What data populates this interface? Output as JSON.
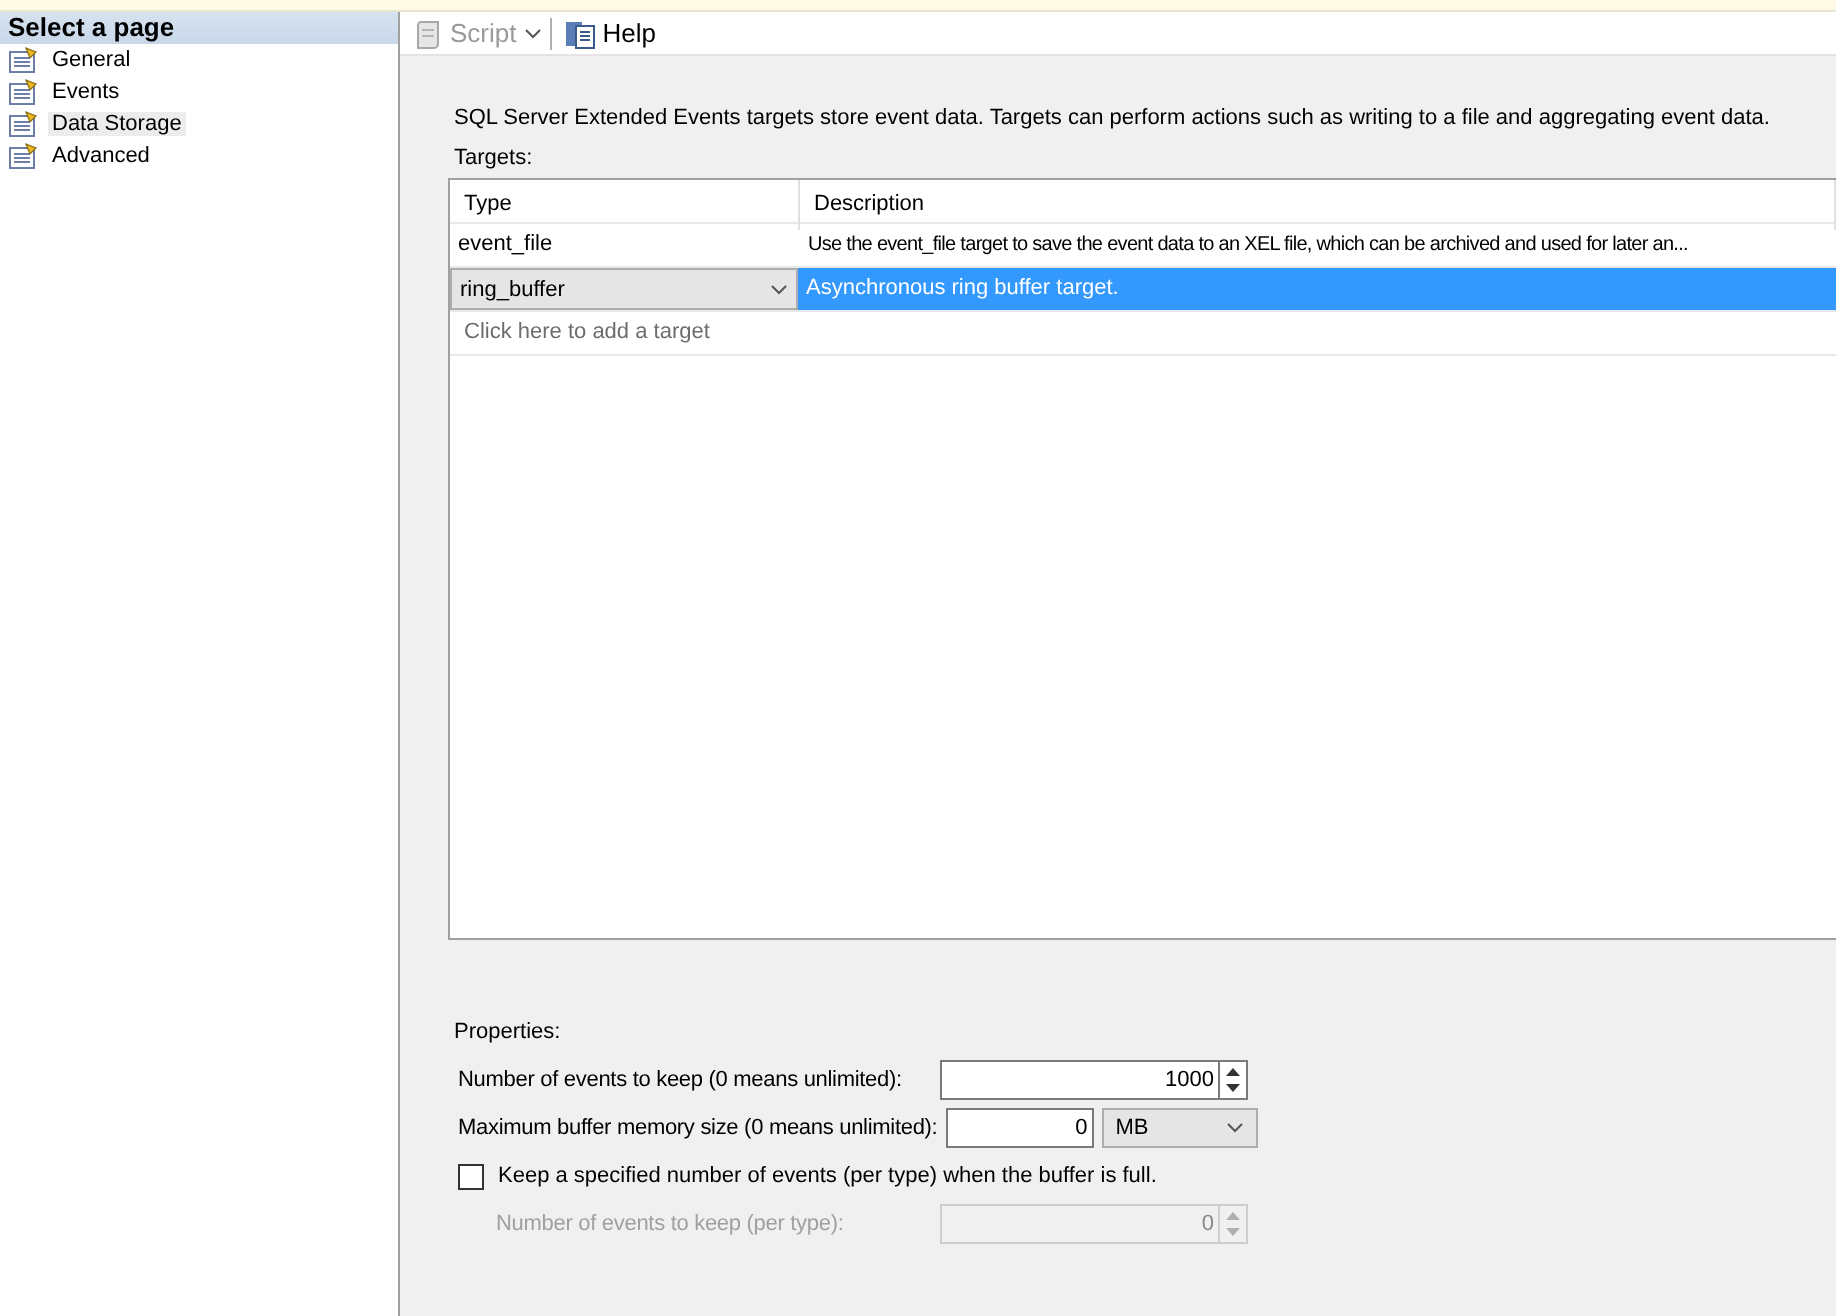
{
  "sidebar": {
    "title": "Select a page",
    "items": [
      {
        "label": "General",
        "selected": false
      },
      {
        "label": "Events",
        "selected": false
      },
      {
        "label": "Data Storage",
        "selected": true
      },
      {
        "label": "Advanced",
        "selected": false
      }
    ]
  },
  "toolbar": [
    {
      "kind": "script",
      "label": "Script",
      "disabled": true
    },
    {
      "kind": "help",
      "label": "Help",
      "disabled": false
    }
  ],
  "description": "SQL Server Extended Events targets store event data. Targets can perform actions such as writing to a file and aggregating event data.",
  "targets": {
    "label": "Targets:",
    "columns": [
      "Type",
      "Description"
    ],
    "rows": [
      {
        "type": "event_file",
        "description": "Use the event_file target to save the event data to an XEL file, which can be archived and used for later an...",
        "selected": false
      },
      {
        "type": "ring_buffer",
        "description": "Asynchronous ring buffer target.",
        "selected": true
      }
    ],
    "add_hint": "Click here to add a target"
  },
  "properties": {
    "label": "Properties:",
    "fields": [
      {
        "kind": "spin",
        "label": "Number of events to keep (0 means unlimited):",
        "value": "1000",
        "disabled": false
      },
      {
        "kind": "size",
        "label": "Maximum buffer memory size (0 means unlimited):",
        "value": "0",
        "unit": "MB"
      },
      {
        "kind": "checkbox",
        "label": "Keep a specified number of events (per type) when the buffer is full.",
        "checked": false
      },
      {
        "kind": "spin",
        "label": "Number of events to keep (per type):",
        "value": "0",
        "disabled": true
      }
    ]
  }
}
